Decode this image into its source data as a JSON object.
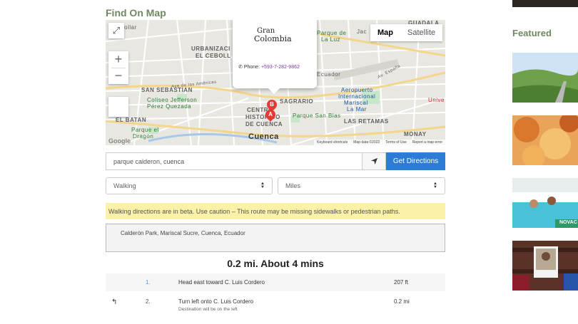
{
  "section_title": "Find On Map",
  "map": {
    "map_type": [
      "Map",
      "Satellite"
    ],
    "labels": {
      "urbanizacion": "URBANIZACI",
      "el_cebollar": "EL CEBOLL",
      "san_sebastian": "SAN SEBASTIAN",
      "coliseo": "Coliseo Jefferson",
      "perez_quezada": "Pérez Quezada",
      "el_batan": "EL BATAN",
      "parque_dragon1": "Parque el",
      "parque_dragon2": "Dragón",
      "centro": "CENTRO",
      "historico": "HISTORICO",
      "de_cuenca": "DE CUENCA",
      "cuenca": "Cuenca",
      "sagrario": "SAGRARIO",
      "parque_san_blas": "Parque San Blas",
      "las_retamas": "LAS RETAMAS",
      "aeropuerto1": "Aeropuerto",
      "aeropuerto2": "Internacional",
      "aeropuerto3": "Mariscal",
      "aeropuerto4": "La Mar",
      "parque_luz1": "Parque de",
      "parque_luz2": "La Luz",
      "ecuador": "Ecuador",
      "guadalajara": "GUADALA",
      "monay": "MONAY",
      "unive": "Unive",
      "cebollar": "Cebollar",
      "ave_americas": "Ave de las Américas",
      "ave_espana": "Av. España",
      "jac": "Jac"
    },
    "infowindow": {
      "logo_line1": "Gran",
      "logo_line2": "Colombia",
      "phone_label": "Phone:",
      "phone_number": "+593-7-282-9862"
    },
    "markers": [
      "A",
      "B"
    ],
    "attribution": {
      "keyboard": "Keyboard shortcuts",
      "mapdata": "Map data ©2022",
      "terms": "Terms of Use",
      "report": "Report a map error",
      "google": "Google"
    }
  },
  "search": {
    "value": "parque calderon, cuenca",
    "button": "Get Directions"
  },
  "mode_select": "Walking",
  "units_select": "Miles",
  "warning": "Walking directions are in beta. Use caution – This route may be missing sidewalks or pedestrian paths.",
  "destination": "Calderón Park, Mariscal Sucre, Cuenca, Ecuador",
  "summary": "0.2 mi. About 4 mins",
  "steps": [
    {
      "num": "1.",
      "instruction": "Head east toward C. Luis Cordero",
      "note": "",
      "distance": "207 ft"
    },
    {
      "num": "2.",
      "instruction": "Turn left onto C. Luis Cordero",
      "note": "Destination will be on the left",
      "distance": "0.2 mi"
    }
  ],
  "sidebar": {
    "featured_title": "Featured",
    "thumb_caption": "NOVAC"
  }
}
